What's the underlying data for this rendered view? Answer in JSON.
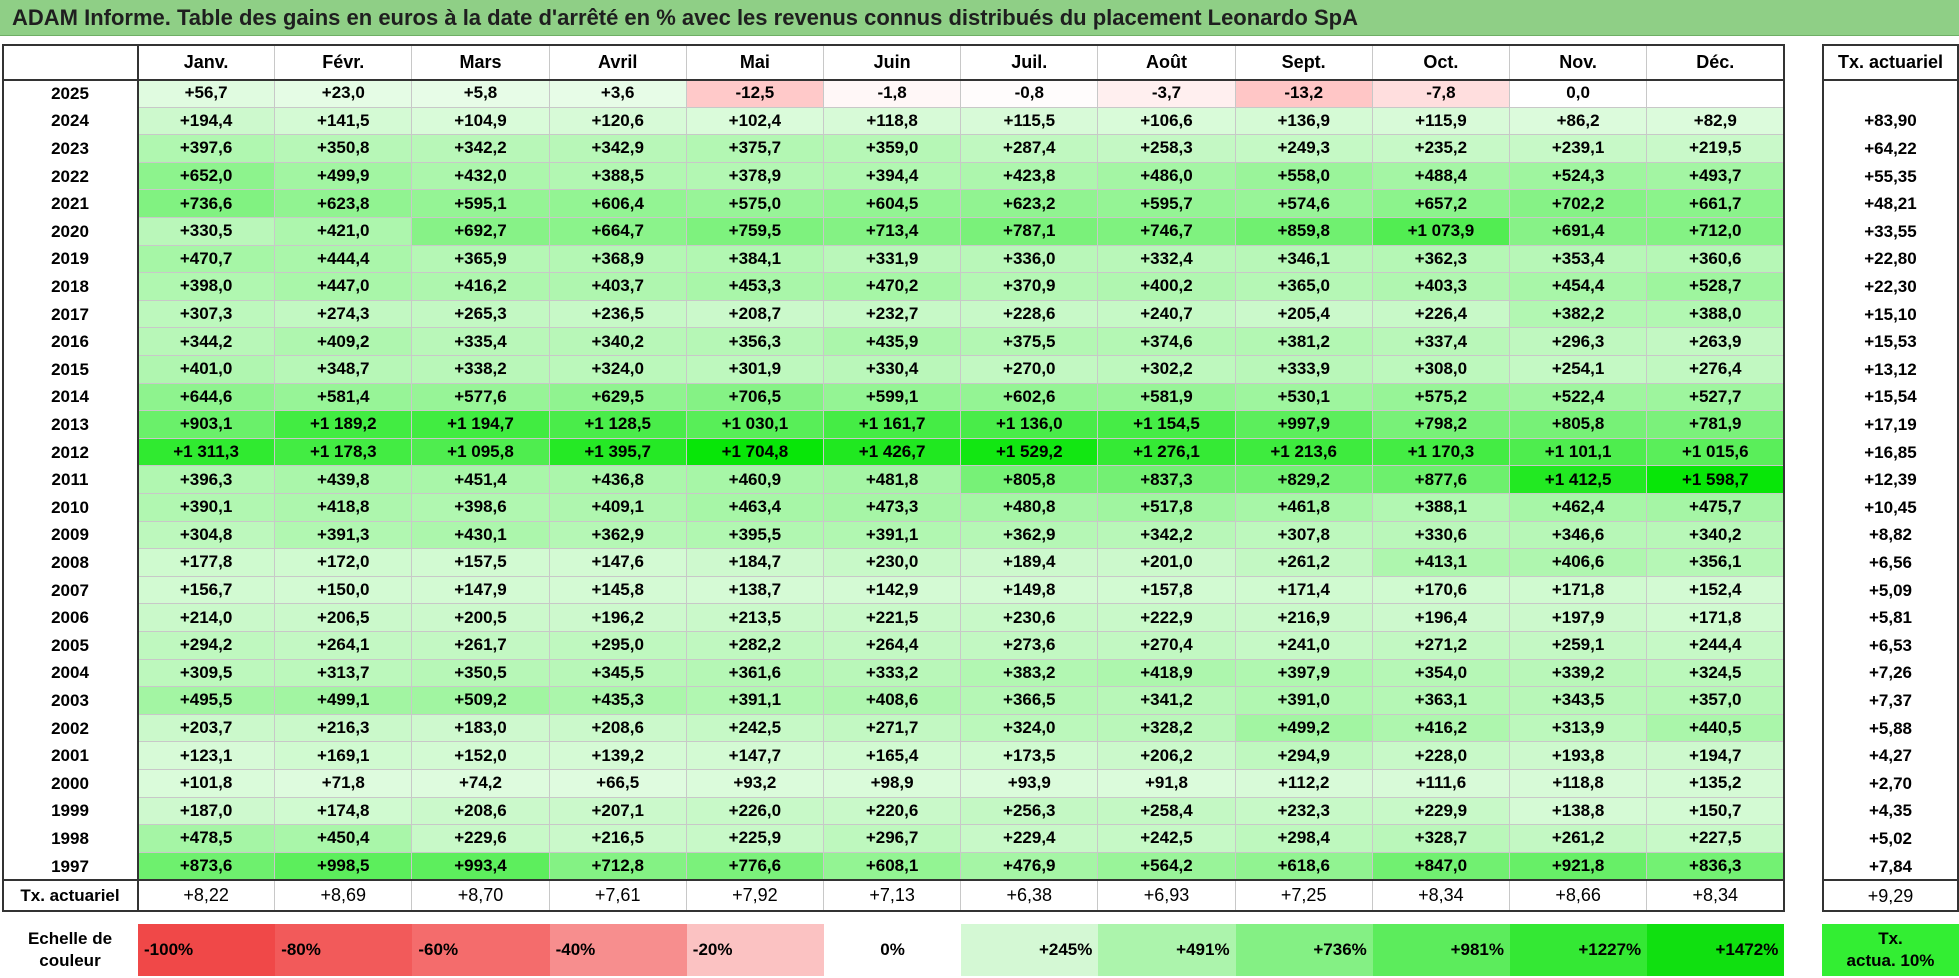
{
  "title": "ADAM Informe. Table des gains en euros à la date d'arrêté en % avec les revenus connus distribués du placement Leonardo SpA",
  "months": [
    "Janv.",
    "Févr.",
    "Mars",
    "Avril",
    "Mai",
    "Juin",
    "Juil.",
    "Août",
    "Sept.",
    "Oct.",
    "Nov.",
    "Déc."
  ],
  "rate_header": "Tx. actuariel",
  "rows": [
    {
      "year": "2025",
      "values": [
        "+56,7",
        "+23,0",
        "+5,8",
        "+3,6",
        "-12,5",
        "-1,8",
        "-0,8",
        "-3,7",
        "-13,2",
        "-7,8",
        "0,0",
        ""
      ],
      "rate": ""
    },
    {
      "year": "2024",
      "values": [
        "+194,4",
        "+141,5",
        "+104,9",
        "+120,6",
        "+102,4",
        "+118,8",
        "+115,5",
        "+106,6",
        "+136,9",
        "+115,9",
        "+86,2",
        "+82,9"
      ],
      "rate": "+83,90"
    },
    {
      "year": "2023",
      "values": [
        "+397,6",
        "+350,8",
        "+342,2",
        "+342,9",
        "+375,7",
        "+359,0",
        "+287,4",
        "+258,3",
        "+249,3",
        "+235,2",
        "+239,1",
        "+219,5"
      ],
      "rate": "+64,22"
    },
    {
      "year": "2022",
      "values": [
        "+652,0",
        "+499,9",
        "+432,0",
        "+388,5",
        "+378,9",
        "+394,4",
        "+423,8",
        "+486,0",
        "+558,0",
        "+488,4",
        "+524,3",
        "+493,7"
      ],
      "rate": "+55,35"
    },
    {
      "year": "2021",
      "values": [
        "+736,6",
        "+623,8",
        "+595,1",
        "+606,4",
        "+575,0",
        "+604,5",
        "+623,2",
        "+595,7",
        "+574,6",
        "+657,2",
        "+702,2",
        "+661,7"
      ],
      "rate": "+48,21"
    },
    {
      "year": "2020",
      "values": [
        "+330,5",
        "+421,0",
        "+692,7",
        "+664,7",
        "+759,5",
        "+713,4",
        "+787,1",
        "+746,7",
        "+859,8",
        "+1 073,9",
        "+691,4",
        "+712,0"
      ],
      "rate": "+33,55"
    },
    {
      "year": "2019",
      "values": [
        "+470,7",
        "+444,4",
        "+365,9",
        "+368,9",
        "+384,1",
        "+331,9",
        "+336,0",
        "+332,4",
        "+346,1",
        "+362,3",
        "+353,4",
        "+360,6"
      ],
      "rate": "+22,80"
    },
    {
      "year": "2018",
      "values": [
        "+398,0",
        "+447,0",
        "+416,2",
        "+403,7",
        "+453,3",
        "+470,2",
        "+370,9",
        "+400,2",
        "+365,0",
        "+403,3",
        "+454,4",
        "+528,7"
      ],
      "rate": "+22,30"
    },
    {
      "year": "2017",
      "values": [
        "+307,3",
        "+274,3",
        "+265,3",
        "+236,5",
        "+208,7",
        "+232,7",
        "+228,6",
        "+240,7",
        "+205,4",
        "+226,4",
        "+382,2",
        "+388,0"
      ],
      "rate": "+15,10"
    },
    {
      "year": "2016",
      "values": [
        "+344,2",
        "+409,2",
        "+335,4",
        "+340,2",
        "+356,3",
        "+435,9",
        "+375,5",
        "+374,6",
        "+381,2",
        "+337,4",
        "+296,3",
        "+263,9"
      ],
      "rate": "+15,53"
    },
    {
      "year": "2015",
      "values": [
        "+401,0",
        "+348,7",
        "+338,2",
        "+324,0",
        "+301,9",
        "+330,4",
        "+270,0",
        "+302,2",
        "+333,9",
        "+308,0",
        "+254,1",
        "+276,4"
      ],
      "rate": "+13,12"
    },
    {
      "year": "2014",
      "values": [
        "+644,6",
        "+581,4",
        "+577,6",
        "+629,5",
        "+706,5",
        "+599,1",
        "+602,6",
        "+581,9",
        "+530,1",
        "+575,2",
        "+522,4",
        "+527,7"
      ],
      "rate": "+15,54"
    },
    {
      "year": "2013",
      "values": [
        "+903,1",
        "+1 189,2",
        "+1 194,7",
        "+1 128,5",
        "+1 030,1",
        "+1 161,7",
        "+1 136,0",
        "+1 154,5",
        "+997,9",
        "+798,2",
        "+805,8",
        "+781,9"
      ],
      "rate": "+17,19"
    },
    {
      "year": "2012",
      "values": [
        "+1 311,3",
        "+1 178,3",
        "+1 095,8",
        "+1 395,7",
        "+1 704,8",
        "+1 426,7",
        "+1 529,2",
        "+1 276,1",
        "+1 213,6",
        "+1 170,3",
        "+1 101,1",
        "+1 015,6"
      ],
      "rate": "+16,85"
    },
    {
      "year": "2011",
      "values": [
        "+396,3",
        "+439,8",
        "+451,4",
        "+436,8",
        "+460,9",
        "+481,8",
        "+805,8",
        "+837,3",
        "+829,2",
        "+877,6",
        "+1 412,5",
        "+1 598,7"
      ],
      "rate": "+12,39"
    },
    {
      "year": "2010",
      "values": [
        "+390,1",
        "+418,8",
        "+398,6",
        "+409,1",
        "+463,4",
        "+473,3",
        "+480,8",
        "+517,8",
        "+461,8",
        "+388,1",
        "+462,4",
        "+475,7"
      ],
      "rate": "+10,45"
    },
    {
      "year": "2009",
      "values": [
        "+304,8",
        "+391,3",
        "+430,1",
        "+362,9",
        "+395,5",
        "+391,1",
        "+362,9",
        "+342,2",
        "+307,8",
        "+330,6",
        "+346,6",
        "+340,2"
      ],
      "rate": "+8,82"
    },
    {
      "year": "2008",
      "values": [
        "+177,8",
        "+172,0",
        "+157,5",
        "+147,6",
        "+184,7",
        "+230,0",
        "+189,4",
        "+201,0",
        "+261,2",
        "+413,1",
        "+406,6",
        "+356,1"
      ],
      "rate": "+6,56"
    },
    {
      "year": "2007",
      "values": [
        "+156,7",
        "+150,0",
        "+147,9",
        "+145,8",
        "+138,7",
        "+142,9",
        "+149,8",
        "+157,8",
        "+171,4",
        "+170,6",
        "+171,8",
        "+152,4"
      ],
      "rate": "+5,09"
    },
    {
      "year": "2006",
      "values": [
        "+214,0",
        "+206,5",
        "+200,5",
        "+196,2",
        "+213,5",
        "+221,5",
        "+230,6",
        "+222,9",
        "+216,9",
        "+196,4",
        "+197,9",
        "+171,8"
      ],
      "rate": "+5,81"
    },
    {
      "year": "2005",
      "values": [
        "+294,2",
        "+264,1",
        "+261,7",
        "+295,0",
        "+282,2",
        "+264,4",
        "+273,6",
        "+270,4",
        "+241,0",
        "+271,2",
        "+259,1",
        "+244,4"
      ],
      "rate": "+6,53"
    },
    {
      "year": "2004",
      "values": [
        "+309,5",
        "+313,7",
        "+350,5",
        "+345,5",
        "+361,6",
        "+333,2",
        "+383,2",
        "+418,9",
        "+397,9",
        "+354,0",
        "+339,2",
        "+324,5"
      ],
      "rate": "+7,26"
    },
    {
      "year": "2003",
      "values": [
        "+495,5",
        "+499,1",
        "+509,2",
        "+435,3",
        "+391,1",
        "+408,6",
        "+366,5",
        "+341,2",
        "+391,0",
        "+363,1",
        "+343,5",
        "+357,0"
      ],
      "rate": "+7,37"
    },
    {
      "year": "2002",
      "values": [
        "+203,7",
        "+216,3",
        "+183,0",
        "+208,6",
        "+242,5",
        "+271,7",
        "+324,0",
        "+328,2",
        "+499,2",
        "+416,2",
        "+313,9",
        "+440,5"
      ],
      "rate": "+5,88"
    },
    {
      "year": "2001",
      "values": [
        "+123,1",
        "+169,1",
        "+152,0",
        "+139,2",
        "+147,7",
        "+165,4",
        "+173,5",
        "+206,2",
        "+294,9",
        "+228,0",
        "+193,8",
        "+194,7"
      ],
      "rate": "+4,27"
    },
    {
      "year": "2000",
      "values": [
        "+101,8",
        "+71,8",
        "+74,2",
        "+66,5",
        "+93,2",
        "+98,9",
        "+93,9",
        "+91,8",
        "+112,2",
        "+111,6",
        "+118,8",
        "+135,2"
      ],
      "rate": "+2,70"
    },
    {
      "year": "1999",
      "values": [
        "+187,0",
        "+174,8",
        "+208,6",
        "+207,1",
        "+226,0",
        "+220,6",
        "+256,3",
        "+258,4",
        "+232,3",
        "+229,9",
        "+138,8",
        "+150,7"
      ],
      "rate": "+4,35"
    },
    {
      "year": "1998",
      "values": [
        "+478,5",
        "+450,4",
        "+229,6",
        "+216,5",
        "+225,9",
        "+296,7",
        "+229,4",
        "+242,5",
        "+298,4",
        "+328,7",
        "+261,2",
        "+227,5"
      ],
      "rate": "+5,02"
    },
    {
      "year": "1997",
      "values": [
        "+873,6",
        "+998,5",
        "+993,4",
        "+712,8",
        "+776,6",
        "+608,1",
        "+476,9",
        "+564,2",
        "+618,6",
        "+847,0",
        "+921,8",
        "+836,3"
      ],
      "rate": "+7,84"
    }
  ],
  "footer": {
    "label": "Tx. actuariel",
    "values": [
      "+8,22",
      "+8,69",
      "+8,70",
      "+7,61",
      "+7,92",
      "+7,13",
      "+6,38",
      "+6,93",
      "+7,25",
      "+8,34",
      "+8,66",
      "+8,34"
    ],
    "rate": "+9,29"
  },
  "legend": {
    "label": "Echelle de\ncouleur",
    "scale": [
      {
        "text": "-100%",
        "color": "#f04848"
      },
      {
        "text": "-80%",
        "color": "#f25a5a"
      },
      {
        "text": "-60%",
        "color": "#f46c6c"
      },
      {
        "text": "-40%",
        "color": "#f78e8e"
      },
      {
        "text": "-20%",
        "color": "#fbc2c2"
      },
      {
        "text": "0%",
        "color": "#ffffff"
      },
      {
        "text": "+245%",
        "color": "#d4f8d4"
      },
      {
        "text": "+491%",
        "color": "#acf4ac"
      },
      {
        "text": "+736%",
        "color": "#84f084"
      },
      {
        "text": "+981%",
        "color": "#5cec5c"
      },
      {
        "text": "+1227%",
        "color": "#34e834"
      },
      {
        "text": "+1472%",
        "color": "#10e010"
      }
    ],
    "actuarial_label": "Tx.\nactua. 10%"
  },
  "colors": {
    "title_bar": "#8fcf86",
    "negative": "#f04848",
    "positive": "#10e010"
  }
}
